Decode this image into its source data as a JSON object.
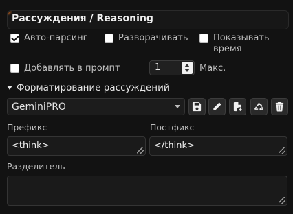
{
  "header": {
    "title": "Рассуждения / Reasoning"
  },
  "options": {
    "auto_parse": {
      "label": "Авто-парсинг",
      "checked": true
    },
    "expand": {
      "label": "Разворачивать",
      "checked": false
    },
    "show_time": {
      "label_line1": "Показывать",
      "label_line2": "время",
      "checked": false
    },
    "add_to_prompt": {
      "label": "Добавлять в промпт",
      "checked": false
    },
    "max_count": {
      "value": "1",
      "label": "Макс."
    }
  },
  "formatting": {
    "section_label": "Форматирование рассуждений",
    "preset_selected": "GeminiPRO",
    "buttons": [
      "save-icon",
      "edit-icon",
      "new-file-icon",
      "recycle-icon",
      "trash-icon"
    ]
  },
  "fields": {
    "prefix": {
      "label": "Префикс",
      "value": "<think>"
    },
    "postfix": {
      "label": "Постфикс",
      "value": "</think>"
    },
    "separator": {
      "label": "Разделитель",
      "value": ""
    }
  },
  "colors": {
    "background": "#121212",
    "text": "#e6e6e6",
    "muted_text": "#bdbdbd",
    "accent_glow": "#a0521c"
  }
}
